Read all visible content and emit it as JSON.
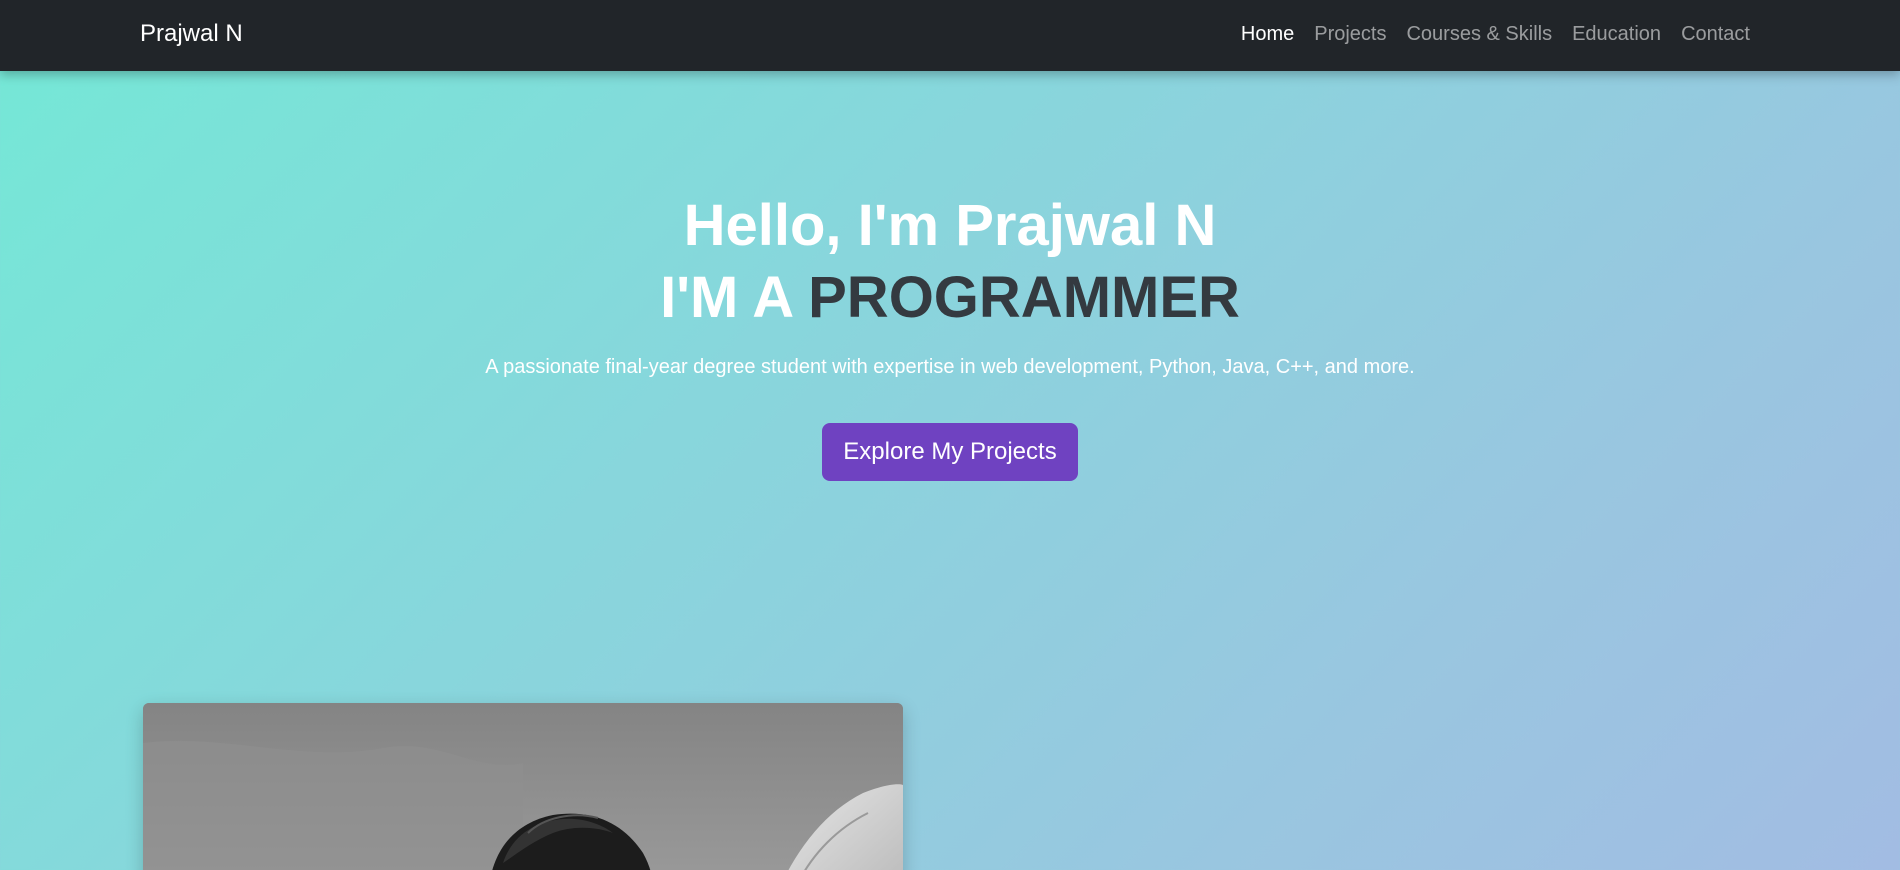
{
  "navbar": {
    "brand": "Prajwal N",
    "links": [
      {
        "label": "Home",
        "active": true
      },
      {
        "label": "Projects",
        "active": false
      },
      {
        "label": "Courses & Skills",
        "active": false
      },
      {
        "label": "Education",
        "active": false
      },
      {
        "label": "Contact",
        "active": false
      }
    ]
  },
  "hero": {
    "title": "Hello, I'm Prajwal N",
    "subtitle_prefix": "I'M A",
    "subtitle_role": "PROGRAMMER",
    "description": "A passionate final-year degree student with expertise in web development, Python, Java, C++, and more.",
    "cta_label": "Explore My Projects"
  },
  "colors": {
    "navbar_bg": "#212529",
    "cta_bg": "#6f42c1",
    "role_text": "#343a40",
    "gradient_start": "#74e8d6",
    "gradient_end": "#a2bce3"
  }
}
